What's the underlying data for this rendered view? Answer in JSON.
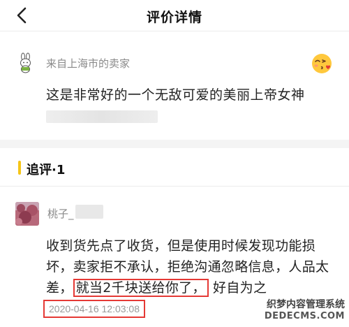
{
  "header": {
    "title": "评价详情",
    "back_icon": "chevron-left-icon"
  },
  "seller": {
    "name": "来自上海市的卖家",
    "comment": "这是非常好的一个无敌可爱的美丽上帝女神",
    "avatar_icon": "bunny-avatar-icon",
    "emoji_icon": "kiss-face-emoji-icon"
  },
  "followup": {
    "title": "追评·1",
    "accent_color": "#f5c518"
  },
  "review": {
    "name": "桃子_",
    "text_before": "收到货先点了收货，但是使用时候发现功能损坏，卖家拒不承认，拒绝沟通忽略信息，人品太差，",
    "text_highlight": "就当2千块送给你了，",
    "text_after": "好自为之",
    "timestamp": "2020-04-16 12:03:08",
    "highlight_color": "#e53935"
  },
  "watermark": {
    "line1": "织梦内容管理系统",
    "line2": "DEDECMS.COM"
  }
}
